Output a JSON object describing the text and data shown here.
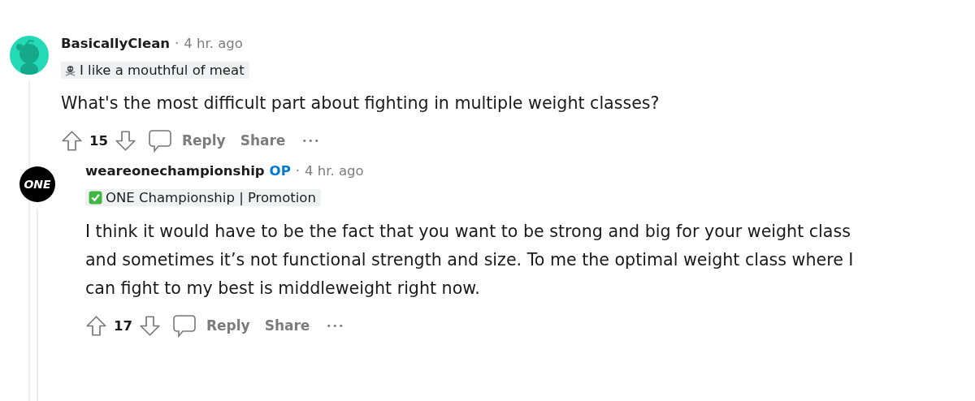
{
  "comments": [
    {
      "author": "BasicallyClean",
      "separator": "·",
      "time": "4 hr. ago",
      "avatar": {
        "kind": "snoo",
        "color": "#24d9b5"
      },
      "flair": {
        "kind": "skull",
        "text": "I like a mouthful of meat"
      },
      "body_lines": [
        "What's the most difficult part about fighting in multiple weight classes?"
      ],
      "votes": "15",
      "actions": [
        "Reply",
        "Share"
      ],
      "more": "•••"
    },
    {
      "author": "weareonechampionship",
      "op": true,
      "op_label": "OP",
      "separator": "·",
      "time": "4 hr. ago",
      "avatar": {
        "kind": "logo",
        "text": "ONE",
        "color": "#000000"
      },
      "flair": {
        "kind": "check",
        "text": "ONE Championship | Promotion"
      },
      "body_lines": [
        "I think it would have to be the fact that you want to be strong and big for your weight class",
        "and sometimes it’s not functional strength and size. To me the optimal weight class where I",
        "can fight to my best is middleweight right now."
      ],
      "votes": "17",
      "actions": [
        "Reply",
        "Share"
      ],
      "more": "•••"
    }
  ]
}
